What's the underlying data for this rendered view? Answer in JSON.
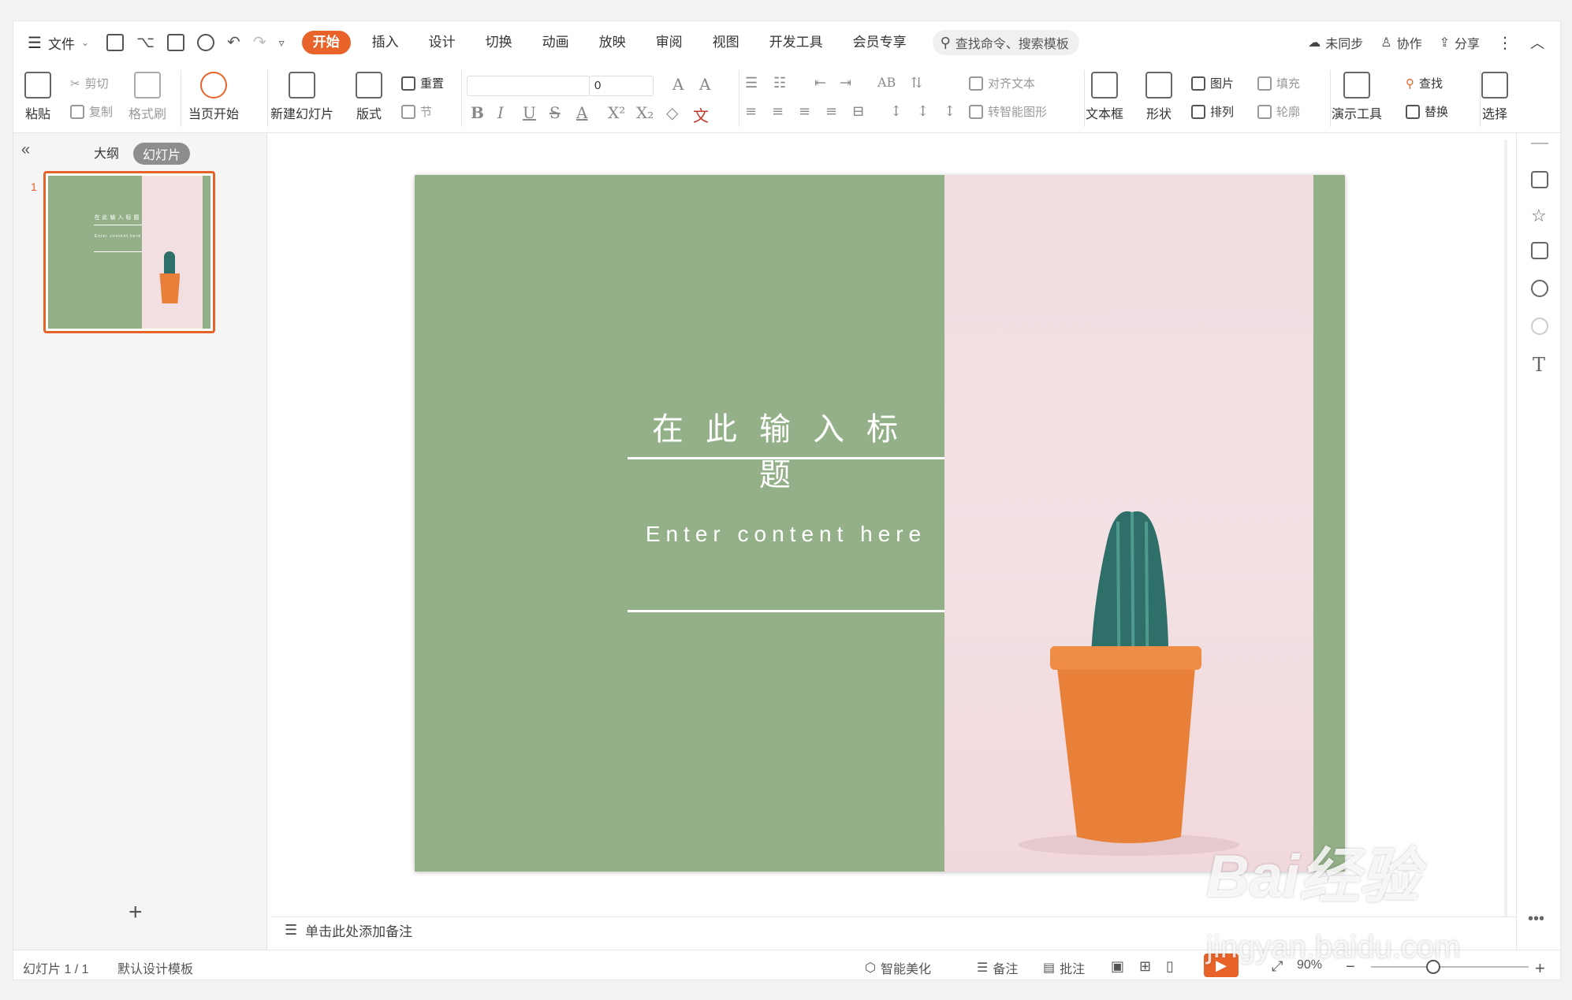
{
  "menubar": {
    "file_label": "文件",
    "tabs": [
      {
        "label": "开始",
        "active": true
      },
      {
        "label": "插入"
      },
      {
        "label": "设计"
      },
      {
        "label": "切换"
      },
      {
        "label": "动画"
      },
      {
        "label": "放映"
      },
      {
        "label": "审阅"
      },
      {
        "label": "视图"
      },
      {
        "label": "开发工具"
      },
      {
        "label": "会员专享"
      }
    ],
    "search_placeholder": "查找命令、搜索模板",
    "unsynced": "未同步",
    "collaborate": "协作",
    "share": "分享"
  },
  "ribbon": {
    "paste": "粘贴",
    "cut": "剪切",
    "copy": "复制",
    "format_painter": "格式刷",
    "play_from_current": "当页开始",
    "new_slide": "新建幻灯片",
    "layout": "版式",
    "reset": "重置",
    "section": "节",
    "font_size_value": "0",
    "align_text": "对齐文本",
    "convert_smartart": "转智能图形",
    "textbox": "文本框",
    "shape": "形状",
    "picture": "图片",
    "arrange": "排列",
    "fill": "填充",
    "outline": "轮廓",
    "presentation_tools": "演示工具",
    "find": "查找",
    "replace": "替换",
    "select": "选择"
  },
  "leftpanel": {
    "tab_outline": "大纲",
    "tab_slides": "幻灯片",
    "slide_number": "1"
  },
  "slide": {
    "title": "在此输入标题",
    "subtitle": "Enter content here",
    "thumb_title": "在此输入标题",
    "thumb_subtitle": "Enter content here"
  },
  "notes_placeholder": "单击此处添加备注",
  "statusbar": {
    "slide_indicator": "幻灯片 1 / 1",
    "template": "默认设计模板",
    "smart_beautify": "智能美化",
    "notes": "备注",
    "comments": "批注",
    "zoom": "90%"
  },
  "watermark": {
    "brand": "Bai经验",
    "url": "jingyan.baidu.com"
  },
  "colors": {
    "accent": "#e8632a",
    "slide_green": "#93b088",
    "photo_pink": "#f2dfe2",
    "pot_orange": "#e8803a",
    "cactus_teal": "#2f6f6a"
  }
}
